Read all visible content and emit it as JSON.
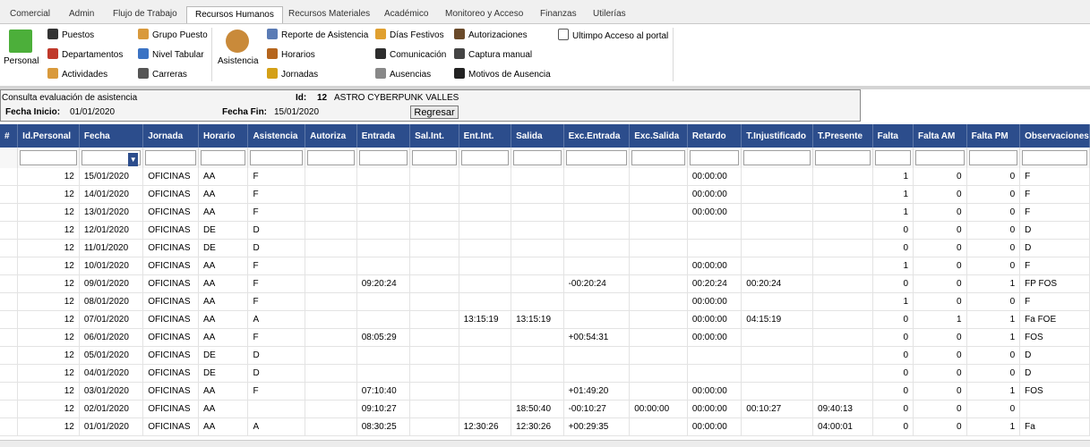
{
  "tabs": [
    "Comercial",
    "Admin",
    "Flujo de Trabajo",
    "Recursos Humanos",
    "Recursos Materiales",
    "Académico",
    "Monitoreo y Acceso",
    "Finanzas",
    "Utilerías"
  ],
  "ribbon": {
    "personal": "Personal",
    "puestos": "Puestos",
    "departamentos": "Departamentos",
    "actividades": "Actividades",
    "grupo_puesto": "Grupo Puesto",
    "nivel_tabular": "Nivel Tabular",
    "carreras": "Carreras",
    "asistencia": "Asistencia",
    "reporte_asistencia": "Reporte de Asistencia",
    "horarios": "Horarios",
    "jornadas": "Jornadas",
    "dias_festivos": "Días Festivos",
    "comunicacion": "Comunicación",
    "ausencias": "Ausencias",
    "autorizaciones": "Autorizaciones",
    "captura_manual": "Captura manual",
    "motivos_ausencia": "Motivos de Ausencia",
    "ultimo_acceso": "Ultimpo Acceso al portal"
  },
  "info": {
    "title": "Consulta evaluación de asistencia",
    "id_label": "Id:",
    "id_value": "12",
    "name": "ASTRO CYBERPUNK VALLES",
    "fecha_inicio_label": "Fecha Inicio:",
    "fecha_inicio": "01/01/2020",
    "fecha_fin_label": "Fecha Fin:",
    "fecha_fin": "15/01/2020",
    "regresar": "Regresar"
  },
  "columns": [
    "#",
    "Id.Personal",
    "Fecha",
    "Jornada",
    "Horario",
    "Asistencia",
    "Autoriza",
    "Entrada",
    "Sal.Int.",
    "Ent.Int.",
    "Salida",
    "Exc.Entrada",
    "Exc.Salida",
    "Retardo",
    "T.Injustificado",
    "T.Presente",
    "Falta",
    "Falta AM",
    "Falta PM",
    "Observaciones"
  ],
  "rows": [
    [
      "",
      "12",
      "15/01/2020",
      "OFICINAS",
      "AA",
      "F",
      "",
      "",
      "",
      "",
      "",
      "",
      "",
      "00:00:00",
      "",
      "",
      "1",
      "0",
      "0",
      "F"
    ],
    [
      "",
      "12",
      "14/01/2020",
      "OFICINAS",
      "AA",
      "F",
      "",
      "",
      "",
      "",
      "",
      "",
      "",
      "00:00:00",
      "",
      "",
      "1",
      "0",
      "0",
      "F"
    ],
    [
      "",
      "12",
      "13/01/2020",
      "OFICINAS",
      "AA",
      "F",
      "",
      "",
      "",
      "",
      "",
      "",
      "",
      "00:00:00",
      "",
      "",
      "1",
      "0",
      "0",
      "F"
    ],
    [
      "",
      "12",
      "12/01/2020",
      "OFICINAS",
      "DE",
      "D",
      "",
      "",
      "",
      "",
      "",
      "",
      "",
      "",
      "",
      "",
      "0",
      "0",
      "0",
      "D"
    ],
    [
      "",
      "12",
      "11/01/2020",
      "OFICINAS",
      "DE",
      "D",
      "",
      "",
      "",
      "",
      "",
      "",
      "",
      "",
      "",
      "",
      "0",
      "0",
      "0",
      "D"
    ],
    [
      "",
      "12",
      "10/01/2020",
      "OFICINAS",
      "AA",
      "F",
      "",
      "",
      "",
      "",
      "",
      "",
      "",
      "00:00:00",
      "",
      "",
      "1",
      "0",
      "0",
      "F"
    ],
    [
      "",
      "12",
      "09/01/2020",
      "OFICINAS",
      "AA",
      "F",
      "",
      "09:20:24",
      "",
      "",
      "",
      "-00:20:24",
      "",
      "00:20:24",
      "00:20:24",
      "",
      "0",
      "0",
      "1",
      "FP FOS"
    ],
    [
      "",
      "12",
      "08/01/2020",
      "OFICINAS",
      "AA",
      "F",
      "",
      "",
      "",
      "",
      "",
      "",
      "",
      "00:00:00",
      "",
      "",
      "1",
      "0",
      "0",
      "F"
    ],
    [
      "",
      "12",
      "07/01/2020",
      "OFICINAS",
      "AA",
      "A",
      "",
      "",
      "",
      "13:15:19",
      "13:15:19",
      "",
      "",
      "00:00:00",
      "04:15:19",
      "",
      "0",
      "1",
      "1",
      "Fa FOE"
    ],
    [
      "",
      "12",
      "06/01/2020",
      "OFICINAS",
      "AA",
      "F",
      "",
      "08:05:29",
      "",
      "",
      "",
      "+00:54:31",
      "",
      "00:00:00",
      "",
      "",
      "0",
      "0",
      "1",
      "FOS"
    ],
    [
      "",
      "12",
      "05/01/2020",
      "OFICINAS",
      "DE",
      "D",
      "",
      "",
      "",
      "",
      "",
      "",
      "",
      "",
      "",
      "",
      "0",
      "0",
      "0",
      "D"
    ],
    [
      "",
      "12",
      "04/01/2020",
      "OFICINAS",
      "DE",
      "D",
      "",
      "",
      "",
      "",
      "",
      "",
      "",
      "",
      "",
      "",
      "0",
      "0",
      "0",
      "D"
    ],
    [
      "",
      "12",
      "03/01/2020",
      "OFICINAS",
      "AA",
      "F",
      "",
      "07:10:40",
      "",
      "",
      "",
      "+01:49:20",
      "",
      "00:00:00",
      "",
      "",
      "0",
      "0",
      "1",
      "FOS"
    ],
    [
      "",
      "12",
      "02/01/2020",
      "OFICINAS",
      "AA",
      "",
      "",
      "09:10:27",
      "",
      "",
      "18:50:40",
      "-00:10:27",
      "00:00:00",
      "00:00:00",
      "00:10:27",
      "09:40:13",
      "0",
      "0",
      "0",
      ""
    ],
    [
      "",
      "12",
      "01/01/2020",
      "OFICINAS",
      "AA",
      "A",
      "",
      "08:30:25",
      "",
      "12:30:26",
      "12:30:26",
      "+00:29:35",
      "",
      "00:00:00",
      "",
      "04:00:01",
      "0",
      "0",
      "1",
      "Fa"
    ]
  ],
  "colors": {
    "header_bg": "#2c4d8c",
    "tabbar_bg": "#f0f0f0",
    "panel_bg": "#f4f4f4"
  }
}
